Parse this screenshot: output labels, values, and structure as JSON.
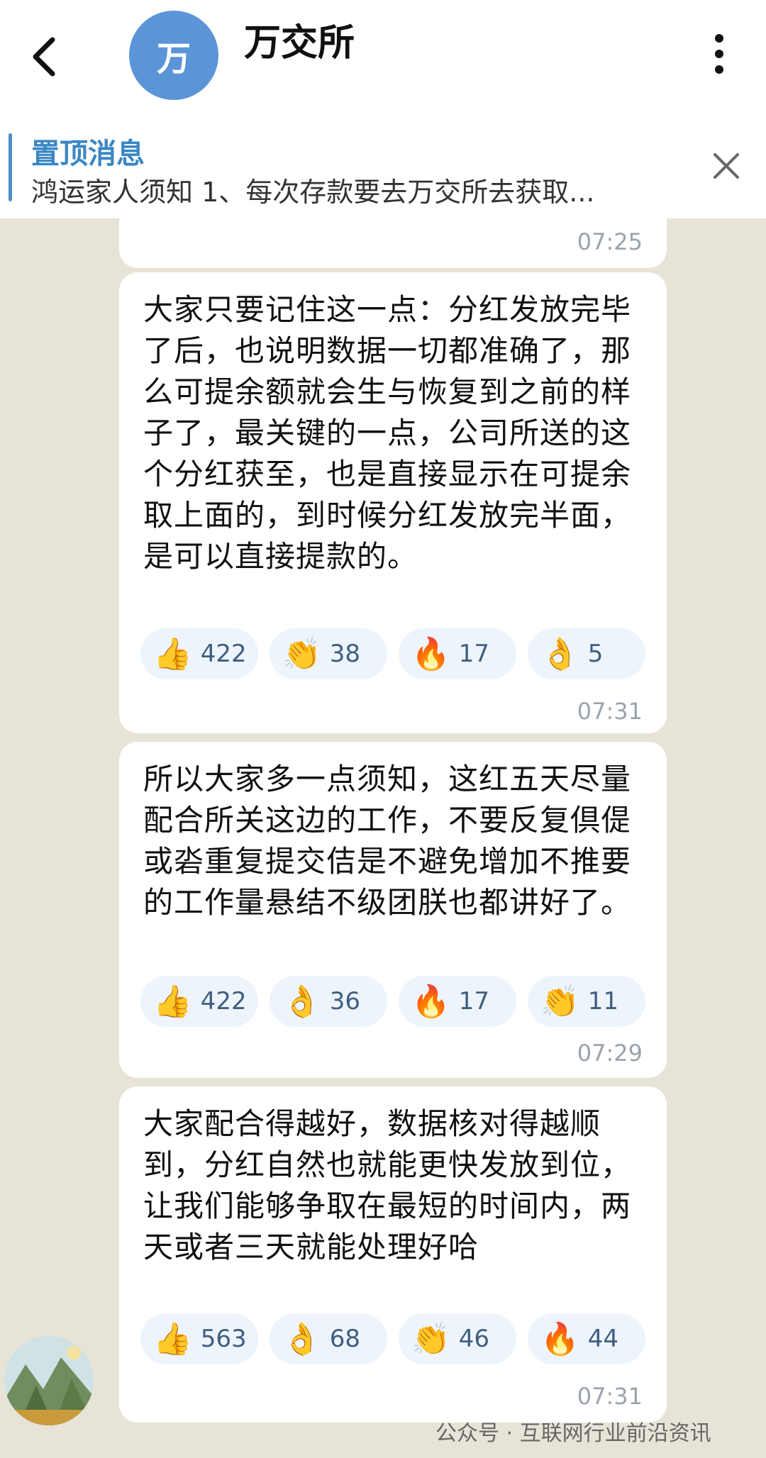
{
  "header": {
    "avatar_letter": "万",
    "title": "万交所"
  },
  "pinned": {
    "title": "置顶消息",
    "text": "鸿运家人须知  1、每次存款要去万交所去获取..."
  },
  "messages": [
    {
      "time": "07:25"
    },
    {
      "text": "大家只要记住这一点：分红发放完毕了后，也说明数据一切都准确了，那么可提余额就会生与恢复到之前的样子了，最关键的一点，公司所送的这个分红获至，也是直接显示在可提余取上面的，到时候分红发放完半面，是可以直接提款的。",
      "reactions": [
        {
          "emoji": "👍",
          "count": "422"
        },
        {
          "emoji": "👏",
          "count": "38"
        },
        {
          "emoji": "🔥",
          "count": "17"
        },
        {
          "emoji": "👌",
          "count": "5"
        }
      ],
      "time": "07:31"
    },
    {
      "text": "所以大家多一点须知，这红五天尽量配合所关这边的工作，不要反复倶偍或沯重复提交佶是不避免增加不推要的工作量悬结不级团朕也都讲好了。",
      "reactions": [
        {
          "emoji": "👍",
          "count": "422"
        },
        {
          "emoji": "👌",
          "count": "36"
        },
        {
          "emoji": "🔥",
          "count": "17"
        },
        {
          "emoji": "👏",
          "count": "11"
        }
      ],
      "time": "07:29"
    },
    {
      "text": "大家配合得越好，数据核对得越顺到，分红自然也就能更快发放到位，让我们能够争取在最短的时间内，两天或者三天就能处理好哈",
      "reactions": [
        {
          "emoji": "👍",
          "count": "563"
        },
        {
          "emoji": "👌",
          "count": "68"
        },
        {
          "emoji": "👏",
          "count": "46"
        },
        {
          "emoji": "🔥",
          "count": "44"
        }
      ],
      "time": "07:31"
    }
  ],
  "watermark": "公众号 · 互联网行业前沿资讯",
  "icons": {
    "back": "back-arrow-icon",
    "menu": "more-vertical-icon",
    "close": "close-icon"
  },
  "colors": {
    "accent": "#3a87c4",
    "avatar_bg": "#5b95d8",
    "chat_bg": "#e7e3d6"
  }
}
